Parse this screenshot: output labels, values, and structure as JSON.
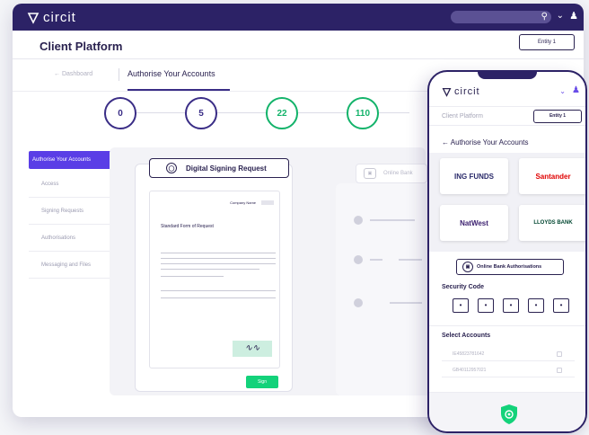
{
  "brand": {
    "name": "circit",
    "accent": "#2c2266",
    "highlight": "#5a3ee6",
    "green": "#13d27a"
  },
  "header": {
    "search_icon": "search-icon",
    "chevron": "⌄",
    "user_icon": "user-icon"
  },
  "platform": {
    "title": "Client Platform",
    "entity_label": "Entity 1"
  },
  "breadcrumb": {
    "back_label": "←  Dashboard",
    "active_label": "Authorise Your Accounts"
  },
  "steps": [
    {
      "value": "0",
      "color": "#3a2d86"
    },
    {
      "value": "5",
      "color": "#3a2d86"
    },
    {
      "value": "22",
      "color": "#13b36a"
    },
    {
      "value": "110",
      "color": "#13b36a"
    }
  ],
  "sidebar": {
    "items": [
      {
        "label": "Authorise Your Accounts"
      },
      {
        "label": "Access"
      },
      {
        "label": "Signing Requests"
      },
      {
        "label": "Authorisations"
      },
      {
        "label": "Messaging and Files"
      }
    ]
  },
  "signing": {
    "tab_label": "Digital Signing Request",
    "company_label": "Company Name",
    "form_title": "Standard Form of Request",
    "signature": "∿∿",
    "sign_button": "Sign"
  },
  "online_bank_tab": {
    "label": "Online Bank"
  },
  "phone": {
    "brand": "circit",
    "subtitle": "Client Platform",
    "entity_label": "Entity 1",
    "heading": "← Authorise Your Accounts",
    "banks": [
      {
        "name": "ING FUNDS",
        "color": "#2a2a6a"
      },
      {
        "name": "Santander",
        "color": "#e00000"
      },
      {
        "name": "NatWest",
        "color": "#3a1e6e"
      },
      {
        "name": "LLOYDS BANK",
        "color": "#024731"
      }
    ],
    "online_auth_button": "Online Bank Authorisations",
    "security_label": "Security Code",
    "code": [
      "•",
      "•",
      "•",
      "•",
      "•"
    ],
    "accounts_label": "Select Accounts",
    "accounts": [
      "IE45823781642",
      "GB40112957021"
    ]
  }
}
